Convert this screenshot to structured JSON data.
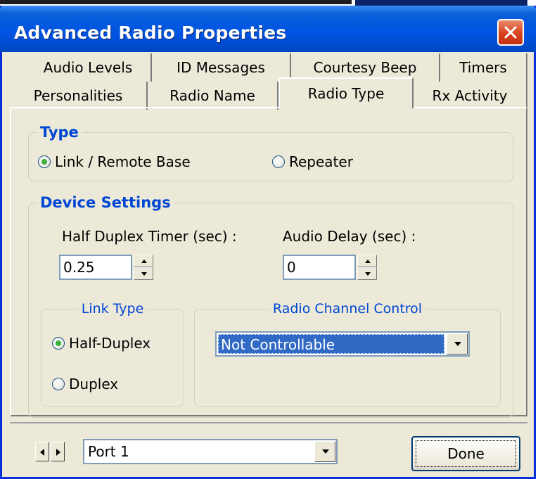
{
  "window": {
    "title": "Advanced Radio Properties"
  },
  "tabs": {
    "row1": [
      "Audio Levels",
      "ID Messages",
      "Courtesy Beep",
      "Timers"
    ],
    "row2": [
      "Personalities",
      "Radio Name",
      "Radio Type",
      "Rx Activity"
    ],
    "selected": "Radio Type"
  },
  "type_group": {
    "legend": "Type",
    "options": [
      "Link / Remote Base",
      "Repeater"
    ],
    "selected": "Link / Remote Base"
  },
  "device_settings": {
    "legend": "Device Settings",
    "half_duplex_timer": {
      "label": "Half Duplex Timer (sec) :",
      "value": "0.25"
    },
    "audio_delay": {
      "label": "Audio Delay (sec) :",
      "value": "0"
    }
  },
  "link_type": {
    "legend": "Link Type",
    "options": [
      "Half-Duplex",
      "Duplex"
    ],
    "selected": "Half-Duplex"
  },
  "radio_channel_control": {
    "legend": "Radio Channel Control",
    "selected": "Not Controllable"
  },
  "footer": {
    "port": "Port 1",
    "done_label": "Done"
  },
  "colors": {
    "titlebar": "#0054e3",
    "group_legend": "#0046d5",
    "selection": "#316ac5",
    "face": "#ece9d8"
  },
  "icons": [
    "close-icon",
    "radio-icon",
    "spin-up-icon",
    "spin-down-icon",
    "dropdown-arrow-icon",
    "scroll-left-icon",
    "scroll-right-icon"
  ]
}
